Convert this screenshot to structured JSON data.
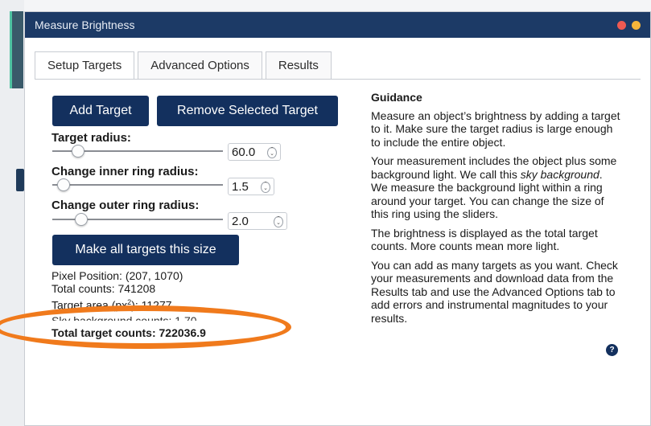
{
  "window": {
    "title": "Measure Brightness"
  },
  "tabs": [
    {
      "label": "Setup Targets"
    },
    {
      "label": "Advanced Options"
    },
    {
      "label": "Results"
    }
  ],
  "buttons": {
    "add_target": "Add Target",
    "remove_target": "Remove Selected Target",
    "make_all": "Make all targets this size"
  },
  "sliders": [
    {
      "label": "Target radius:",
      "value": "60.0",
      "level": 0.12
    },
    {
      "label": "Change inner ring radius:",
      "value": "1.5",
      "level": 0.03
    },
    {
      "label": "Change outer ring radius:",
      "value": "2.0",
      "level": 0.14
    }
  ],
  "info": {
    "pixel_position": "Pixel Position: (207, 1070)",
    "total_counts": "Total counts: 741208",
    "target_area_prefix": "Target area (px",
    "target_area_sup": "2",
    "target_area_suffix": "): 11277",
    "sky_partial": "Sky background counts: 1.70",
    "total_target_label": "Total target counts",
    "total_target_value": ": 722036.9"
  },
  "guidance": {
    "heading": "Guidance",
    "p1": "Measure an object’s brightness by adding a target to it. Make sure the target radius is large enough to include the entire object.",
    "p2a": "Your measurement includes the object plus some background light. We call this ",
    "p2em": "sky background",
    "p2b": ". We measure the background light within a ring around your target. You can change the size of this ring using the sliders.",
    "p3": "The brightness is displayed as the total target counts. More counts mean more light.",
    "p4": "You can add as many targets as you want. Check your measurements and download data from the Results tab and use the Advanced Options tab to add errors and instrumental magnitudes to your results.",
    "help": "?"
  },
  "colors": {
    "titlebar": "#1c3a66",
    "button": "#13305e",
    "highlight": "#f07a1c"
  }
}
